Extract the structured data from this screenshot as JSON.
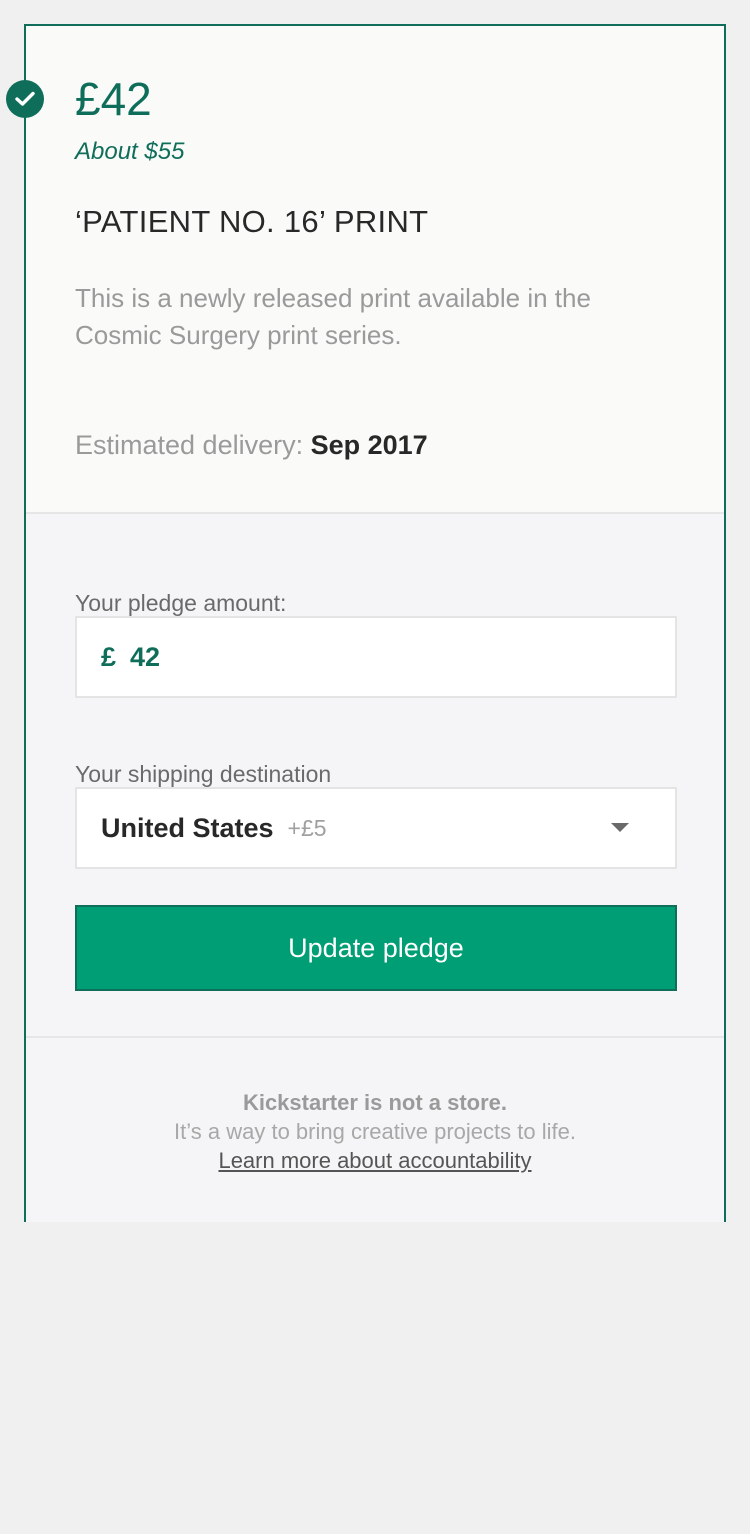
{
  "reward": {
    "price": "£42",
    "converted_price": "About $55",
    "title": "‘PATIENT NO. 16’ PRINT",
    "description": "This is a newly released print available in the Cosmic Surgery print series.",
    "delivery_label": "Estimated delivery:",
    "delivery_value": "Sep 2017",
    "selected_icon": "check-icon"
  },
  "pledge": {
    "amount_label": "Your pledge amount:",
    "currency_symbol": "£",
    "amount_value": "42",
    "shipping_label": "Your shipping destination",
    "shipping_country": "United States",
    "shipping_cost": "+£5",
    "dropdown_icon": "caret-down-icon",
    "update_button_label": "Update pledge"
  },
  "footer": {
    "headline": "Kickstarter is not a store.",
    "subline": "It’s a way to bring creative projects to life.",
    "link_label": "Learn more about accountability"
  },
  "colors": {
    "brand_dark": "#0f6e5a",
    "button_green": "#009e74",
    "muted_text": "#9a9a9a"
  }
}
